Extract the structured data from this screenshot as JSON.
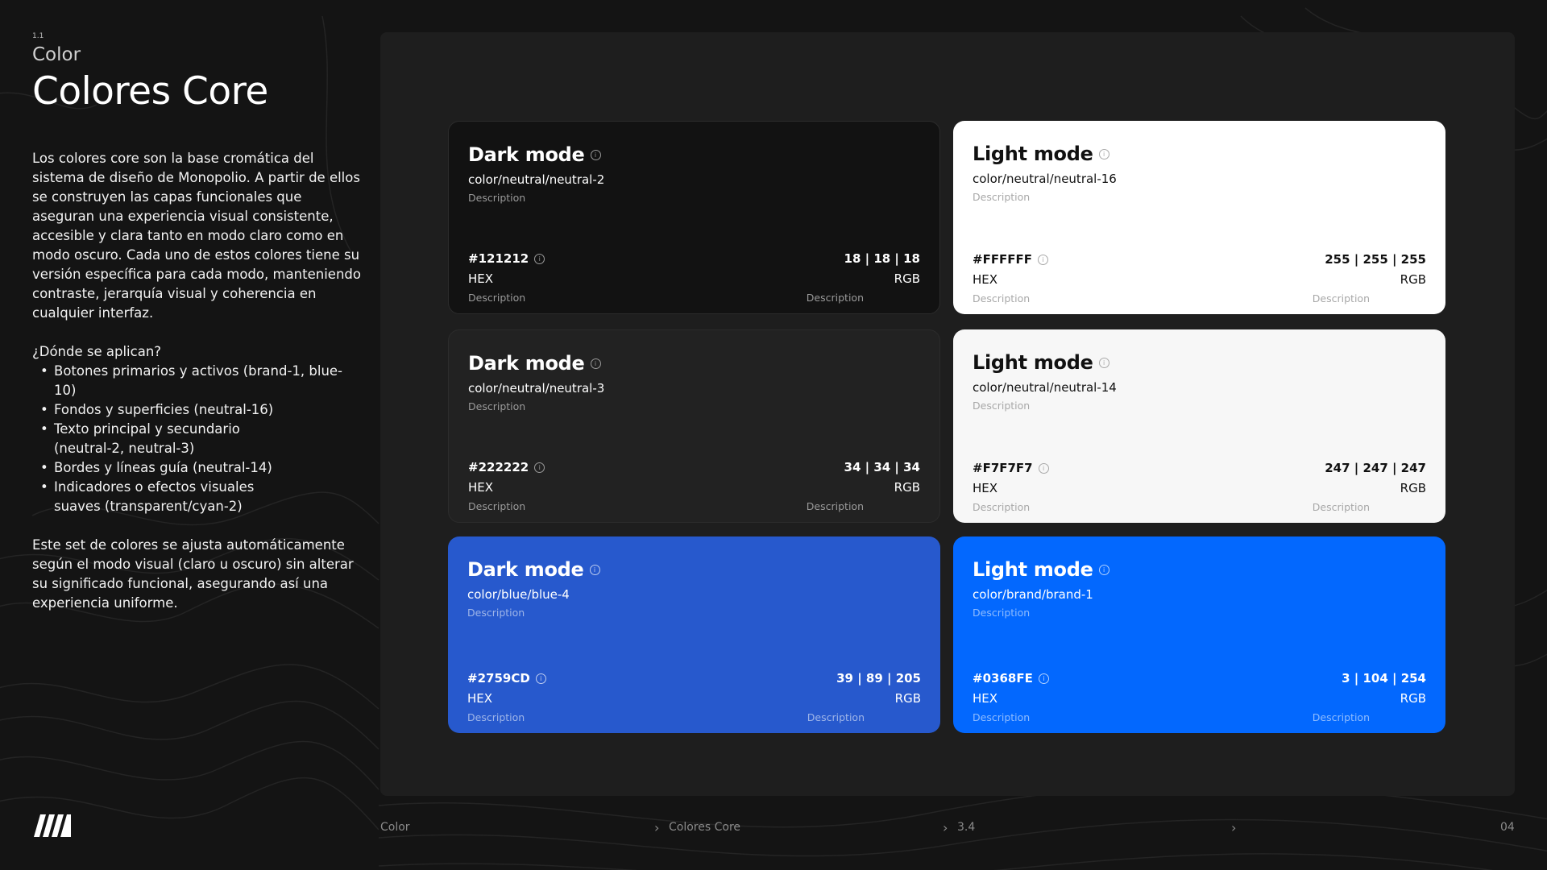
{
  "left": {
    "section_number": "1.1",
    "section": "Color",
    "title": "Colores Core",
    "paragraph1": "Los colores core son la base cromática del sistema de diseño de Monopolio. A partir de ellos se construyen las capas funcionales que aseguran una experiencia visual consistente, accesible y clara tanto en modo claro como en modo oscuro. Cada uno de estos colores tiene su versión específica para cada modo, manteniendo contraste, jerarquía visual y coherencia en cualquier interfaz.",
    "question": "¿Dónde se aplican?",
    "bullets": [
      "Botones primarios y activos (brand-1, blue-10)",
      "Fondos y superficies (neutral-16)",
      "Texto principal y secundario (neutral-2, neutral-3)",
      "Bordes y líneas guía (neutral-14)",
      "Indicadores o efectos visuales suaves (transparent/cyan-2)"
    ],
    "paragraph2": "Este set de colores se ajusta automáticamente según el modo visual (claro u oscuro) sin alterar su significado funcional, asegurando así una experiencia uniforme."
  },
  "cards": [
    {
      "mode": "Dark mode",
      "token": "color/neutral/neutral-2",
      "description": "Description",
      "hex": "#121212",
      "hex_label": "HEX",
      "hex_description": "Description",
      "rgb": "18 | 18 | 18",
      "rgb_label": "RGB",
      "rgb_description": "Description",
      "swatch": "#121212"
    },
    {
      "mode": "Light mode",
      "token": "color/neutral/neutral-16",
      "description": "Description",
      "hex": "#FFFFFF",
      "hex_label": "HEX",
      "hex_description": "Description",
      "rgb": "255 | 255 | 255",
      "rgb_label": "RGB",
      "rgb_description": "Description",
      "swatch": "#FFFFFF"
    },
    {
      "mode": "Dark mode",
      "token": "color/neutral/neutral-3",
      "description": "Description",
      "hex": "#222222",
      "hex_label": "HEX",
      "hex_description": "Description",
      "rgb": "34 | 34 | 34",
      "rgb_label": "RGB",
      "rgb_description": "Description",
      "swatch": "#222222"
    },
    {
      "mode": "Light mode",
      "token": "color/neutral/neutral-14",
      "description": "Description",
      "hex": "#F7F7F7",
      "hex_label": "HEX",
      "hex_description": "Description",
      "rgb": "247 | 247 | 247",
      "rgb_label": "RGB",
      "rgb_description": "Description",
      "swatch": "#F7F7F7"
    },
    {
      "mode": "Dark mode",
      "token": "color/blue/blue-4",
      "description": "Description",
      "hex": "#2759CD",
      "hex_label": "HEX",
      "hex_description": "Description",
      "rgb": "39 | 89 | 205",
      "rgb_label": "RGB",
      "rgb_description": "Description",
      "swatch": "#2759CD"
    },
    {
      "mode": "Light mode",
      "token": "color/brand/brand-1",
      "description": "Description",
      "hex": "#0368FE",
      "hex_label": "HEX",
      "hex_description": "Description",
      "rgb": "3 | 104 | 254",
      "rgb_label": "RGB",
      "rgb_description": "Description",
      "swatch": "#0368FE"
    }
  ],
  "footer": {
    "crumb1": "Color",
    "crumb2": "Colores Core",
    "crumb3": "3.4",
    "page": "04"
  },
  "icons": {
    "info": "info-icon",
    "chevron": "chevron-right-icon",
    "logo": "monopolio-logo"
  }
}
